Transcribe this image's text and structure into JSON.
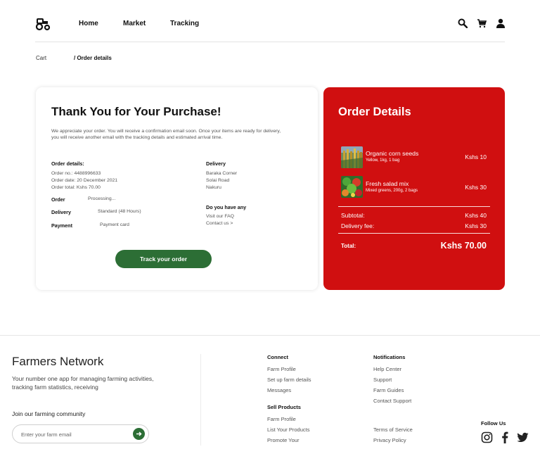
{
  "header": {
    "nav": [
      "Home",
      "Market",
      "Tracking"
    ]
  },
  "breadcrumb": {
    "root": "Cart",
    "current": "/ Order details"
  },
  "thank_you": {
    "title": "Thank You for Your Purchase!",
    "message": "We appreciate your order. You will receive a confirmation email soon. Once your items are ready for delivery, you will receive another email with the tracking details and estimated arrival time.",
    "order_details_heading": "Order details:",
    "order_no": "Order no.: 4488996633",
    "order_date": "Order date: 20 December 2021",
    "order_total": "Order total: Kshs 70.00",
    "delivery_heading": "Delivery",
    "address": [
      "Baraka Corner",
      "Solai Road",
      "Nakuru"
    ],
    "order_label": "Order",
    "order_status": "Processing...",
    "delivery_label": "Delivery",
    "delivery_value": "Standard (48 Hours)",
    "payment_label": "Payment",
    "payment_value": "Payment card",
    "help_heading": "Do you have any",
    "faq_link": "Visit our FAQ",
    "contact_link": "Contact us >",
    "track_button": "Track your order"
  },
  "order_summary": {
    "title": "Order Details",
    "items": [
      {
        "name": "Organic corn seeds",
        "details": "Yellow, 1kg, 1 bag",
        "price": "Kshs 10"
      },
      {
        "name": "Fresh salad mix",
        "details": "Mixed greens, 200g, 2 bags",
        "price": "Kshs 30"
      }
    ],
    "subtotal_label": "Subtotal:",
    "subtotal_value": "Kshs 40",
    "delivery_fee_label": "Delivery fee:",
    "delivery_fee_value": "Kshs 30",
    "total_label": "Total:",
    "total_value": "Kshs 70.00"
  },
  "footer": {
    "brand": "Farmers Network",
    "tagline": "Your number one app for managing farming activities, tracking farm statistics, receiving",
    "join_label": "Join our farming community",
    "email_placeholder": "Enter your farm email",
    "connect_heading": "Connect",
    "connect_links": [
      "Farm Profile",
      "Set up farm details",
      "Messages"
    ],
    "sell_heading": "Sell Products",
    "sell_links": [
      "Farm Profile",
      "List Your Products",
      "Promote Your"
    ],
    "notifications_heading": "Notifications",
    "notification_links": [
      "Help Center",
      "Support",
      "Farm Guides",
      "Contact Support"
    ],
    "legal_links": [
      "Terms of Service",
      "Privacy Policy"
    ],
    "follow_label": "Follow Us"
  },
  "colors": {
    "brand_green": "#2c6e35",
    "order_card_red": "#d00f10"
  },
  "icons": [
    "tractor-logo-icon",
    "search-icon",
    "cart-icon",
    "user-icon",
    "arrow-right-icon",
    "instagram-icon",
    "facebook-icon",
    "twitter-icon"
  ]
}
